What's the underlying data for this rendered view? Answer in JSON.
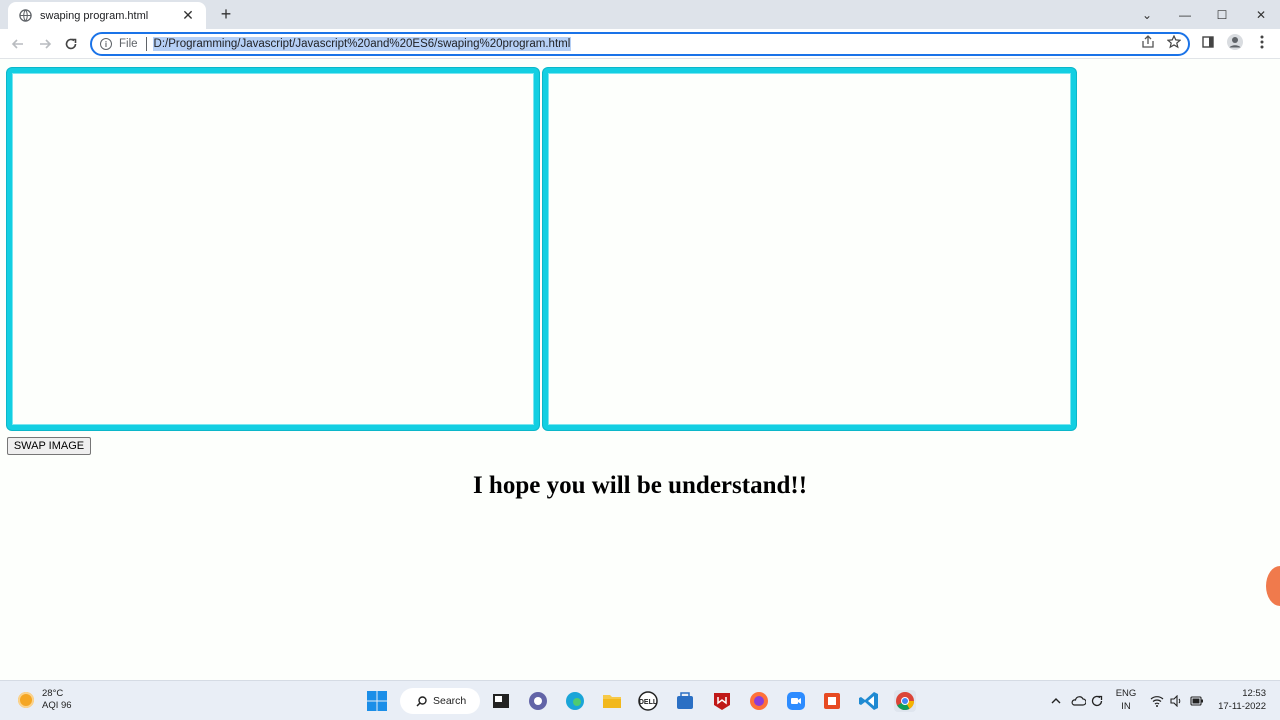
{
  "browser": {
    "tab_title": "swaping program.html",
    "new_tab_symbol": "+",
    "tab_close_symbol": "✕",
    "omnibox": {
      "scheme_label": "File",
      "url": "D:/Programming/Javascript/Javascript%20and%20ES6/swaping%20program.html"
    },
    "window_controls": {
      "minimize": "—",
      "maximize": "☐",
      "close": "✕",
      "tab_search": "⌄"
    }
  },
  "page": {
    "image_left_alt": "",
    "image_right_alt": "",
    "swap_button_label": "SWAP IMAGE",
    "message": "I hope you will be understand!!",
    "border_color": "#13cfe2"
  },
  "taskbar": {
    "weather": {
      "temperature": "28°C",
      "aqi": "AQI 96"
    },
    "search_label": "Search",
    "language": {
      "line1": "ENG",
      "line2": "IN"
    },
    "clock": {
      "time": "12:53",
      "date": "17-11-2022"
    },
    "apps": [
      "windows-start-icon",
      "file-explorer-icon",
      "teams-chat-icon",
      "edge-icon",
      "folder-icon",
      "dell-icon",
      "store-icon",
      "mcafee-icon",
      "firefox-icon",
      "zoom-icon",
      "office-icon",
      "vscode-icon",
      "chrome-icon"
    ]
  }
}
